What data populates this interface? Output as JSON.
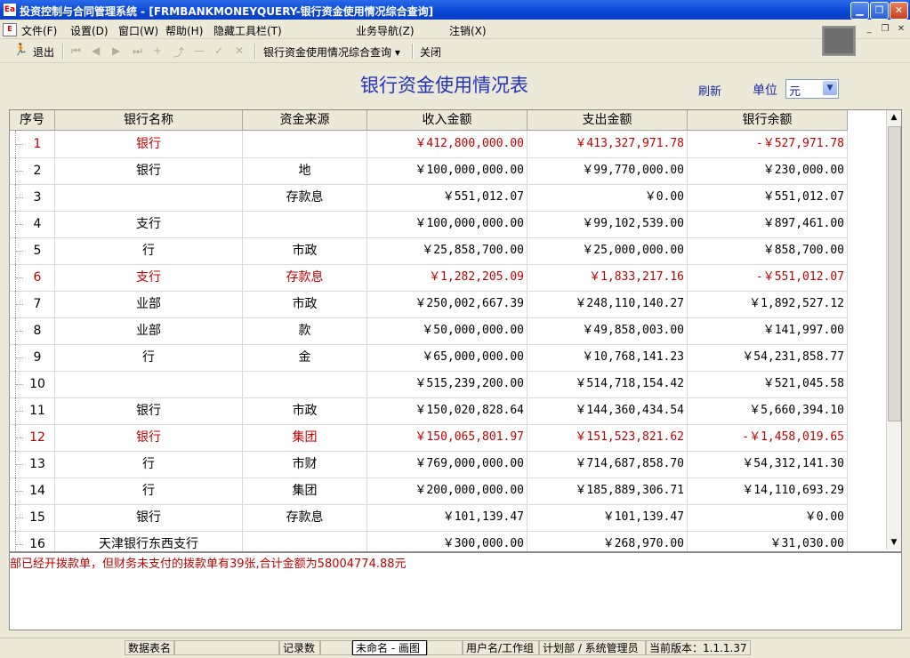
{
  "window": {
    "title": "投资控制与合同管理系统 - [FRMBANKMONEYQUERY-银行资金使用情况综合查询]",
    "app_icon_text": "Ea"
  },
  "menu": {
    "items": [
      "文件(F)",
      "设置(D)",
      "窗口(W)",
      "帮助(H)",
      "隐藏工具栏(T)",
      "业务导航(Z)",
      "注销(X)"
    ]
  },
  "toolbar": {
    "exit_label": "退出",
    "nav_glyphs": [
      "⏮",
      "◀",
      "▶",
      "⏭",
      "+",
      "⤴",
      "—",
      "✓",
      "✕"
    ],
    "window_selector": "银行资金使用情况综合查询",
    "close_label": "关闭"
  },
  "report": {
    "title": "银行资金使用情况表",
    "refresh_label": "刷新",
    "unit_label": "单位",
    "unit_value": "元"
  },
  "table": {
    "headers": [
      "序号",
      "银行名称",
      "资金来源",
      "收入金额",
      "支出金额",
      "银行余额"
    ],
    "rows": [
      {
        "no": "1",
        "bank": "银行",
        "source": "",
        "income": "￥412,800,000.00",
        "expense": "￥413,327,971.78",
        "balance": "-￥527,971.78",
        "highlight": true
      },
      {
        "no": "2",
        "bank": "银行",
        "source": "地",
        "income": "￥100,000,000.00",
        "expense": "￥99,770,000.00",
        "balance": "￥230,000.00",
        "highlight": false
      },
      {
        "no": "3",
        "bank": "",
        "source": "存款息",
        "income": "￥551,012.07",
        "expense": "￥0.00",
        "balance": "￥551,012.07",
        "highlight": false
      },
      {
        "no": "4",
        "bank": "支行",
        "source": "",
        "income": "￥100,000,000.00",
        "expense": "￥99,102,539.00",
        "balance": "￥897,461.00",
        "highlight": false
      },
      {
        "no": "5",
        "bank": "行",
        "source": "市政",
        "income": "￥25,858,700.00",
        "expense": "￥25,000,000.00",
        "balance": "￥858,700.00",
        "highlight": false
      },
      {
        "no": "6",
        "bank": "支行",
        "source": "存款息",
        "income": "￥1,282,205.09",
        "expense": "￥1,833,217.16",
        "balance": "-￥551,012.07",
        "highlight": true
      },
      {
        "no": "7",
        "bank": "业部",
        "source": "市政",
        "income": "￥250,002,667.39",
        "expense": "￥248,110,140.27",
        "balance": "￥1,892,527.12",
        "highlight": false
      },
      {
        "no": "8",
        "bank": "业部",
        "source": "款",
        "income": "￥50,000,000.00",
        "expense": "￥49,858,003.00",
        "balance": "￥141,997.00",
        "highlight": false
      },
      {
        "no": "9",
        "bank": "行",
        "source": "金",
        "income": "￥65,000,000.00",
        "expense": "￥10,768,141.23",
        "balance": "￥54,231,858.77",
        "highlight": false
      },
      {
        "no": "10",
        "bank": "",
        "source": "",
        "income": "￥515,239,200.00",
        "expense": "￥514,718,154.42",
        "balance": "￥521,045.58",
        "highlight": false
      },
      {
        "no": "11",
        "bank": "银行",
        "source": "市政",
        "income": "￥150,020,828.64",
        "expense": "￥144,360,434.54",
        "balance": "￥5,660,394.10",
        "highlight": false
      },
      {
        "no": "12",
        "bank": "银行",
        "source": "集团",
        "income": "￥150,065,801.97",
        "expense": "￥151,523,821.62",
        "balance": "-￥1,458,019.65",
        "highlight": true
      },
      {
        "no": "13",
        "bank": "行",
        "source": "市财",
        "income": "￥769,000,000.00",
        "expense": "￥714,687,858.70",
        "balance": "￥54,312,141.30",
        "highlight": false
      },
      {
        "no": "14",
        "bank": "行",
        "source": "集团",
        "income": "￥200,000,000.00",
        "expense": "￥185,889,306.71",
        "balance": "￥14,110,693.29",
        "highlight": false
      },
      {
        "no": "15",
        "bank": "银行",
        "source": "存款息",
        "income": "￥101,139.47",
        "expense": "￥101,139.47",
        "balance": "￥0.00",
        "highlight": false
      },
      {
        "no": "16",
        "bank": "天津银行东西支行",
        "source": "",
        "income": "￥300,000.00",
        "expense": "￥268,970.00",
        "balance": "￥31,030.00",
        "highlight": false
      }
    ]
  },
  "message": "部已经开拨款单，但财务未支付的拨款单有39张,合计金额为58004774.88元",
  "status": {
    "table_name_label": "数据表名",
    "record_count_label": "记录数",
    "active_doc": "未命名 - 画图",
    "user_label": "用户名/工作组",
    "user_value": "计划部 / 系统管理员",
    "version": "当前版本：1.1.1.37"
  },
  "colors": {
    "title_bar": "#0a46d4",
    "report_title": "#2233bb",
    "negative_row": "#c00000",
    "message": "#c00000"
  }
}
